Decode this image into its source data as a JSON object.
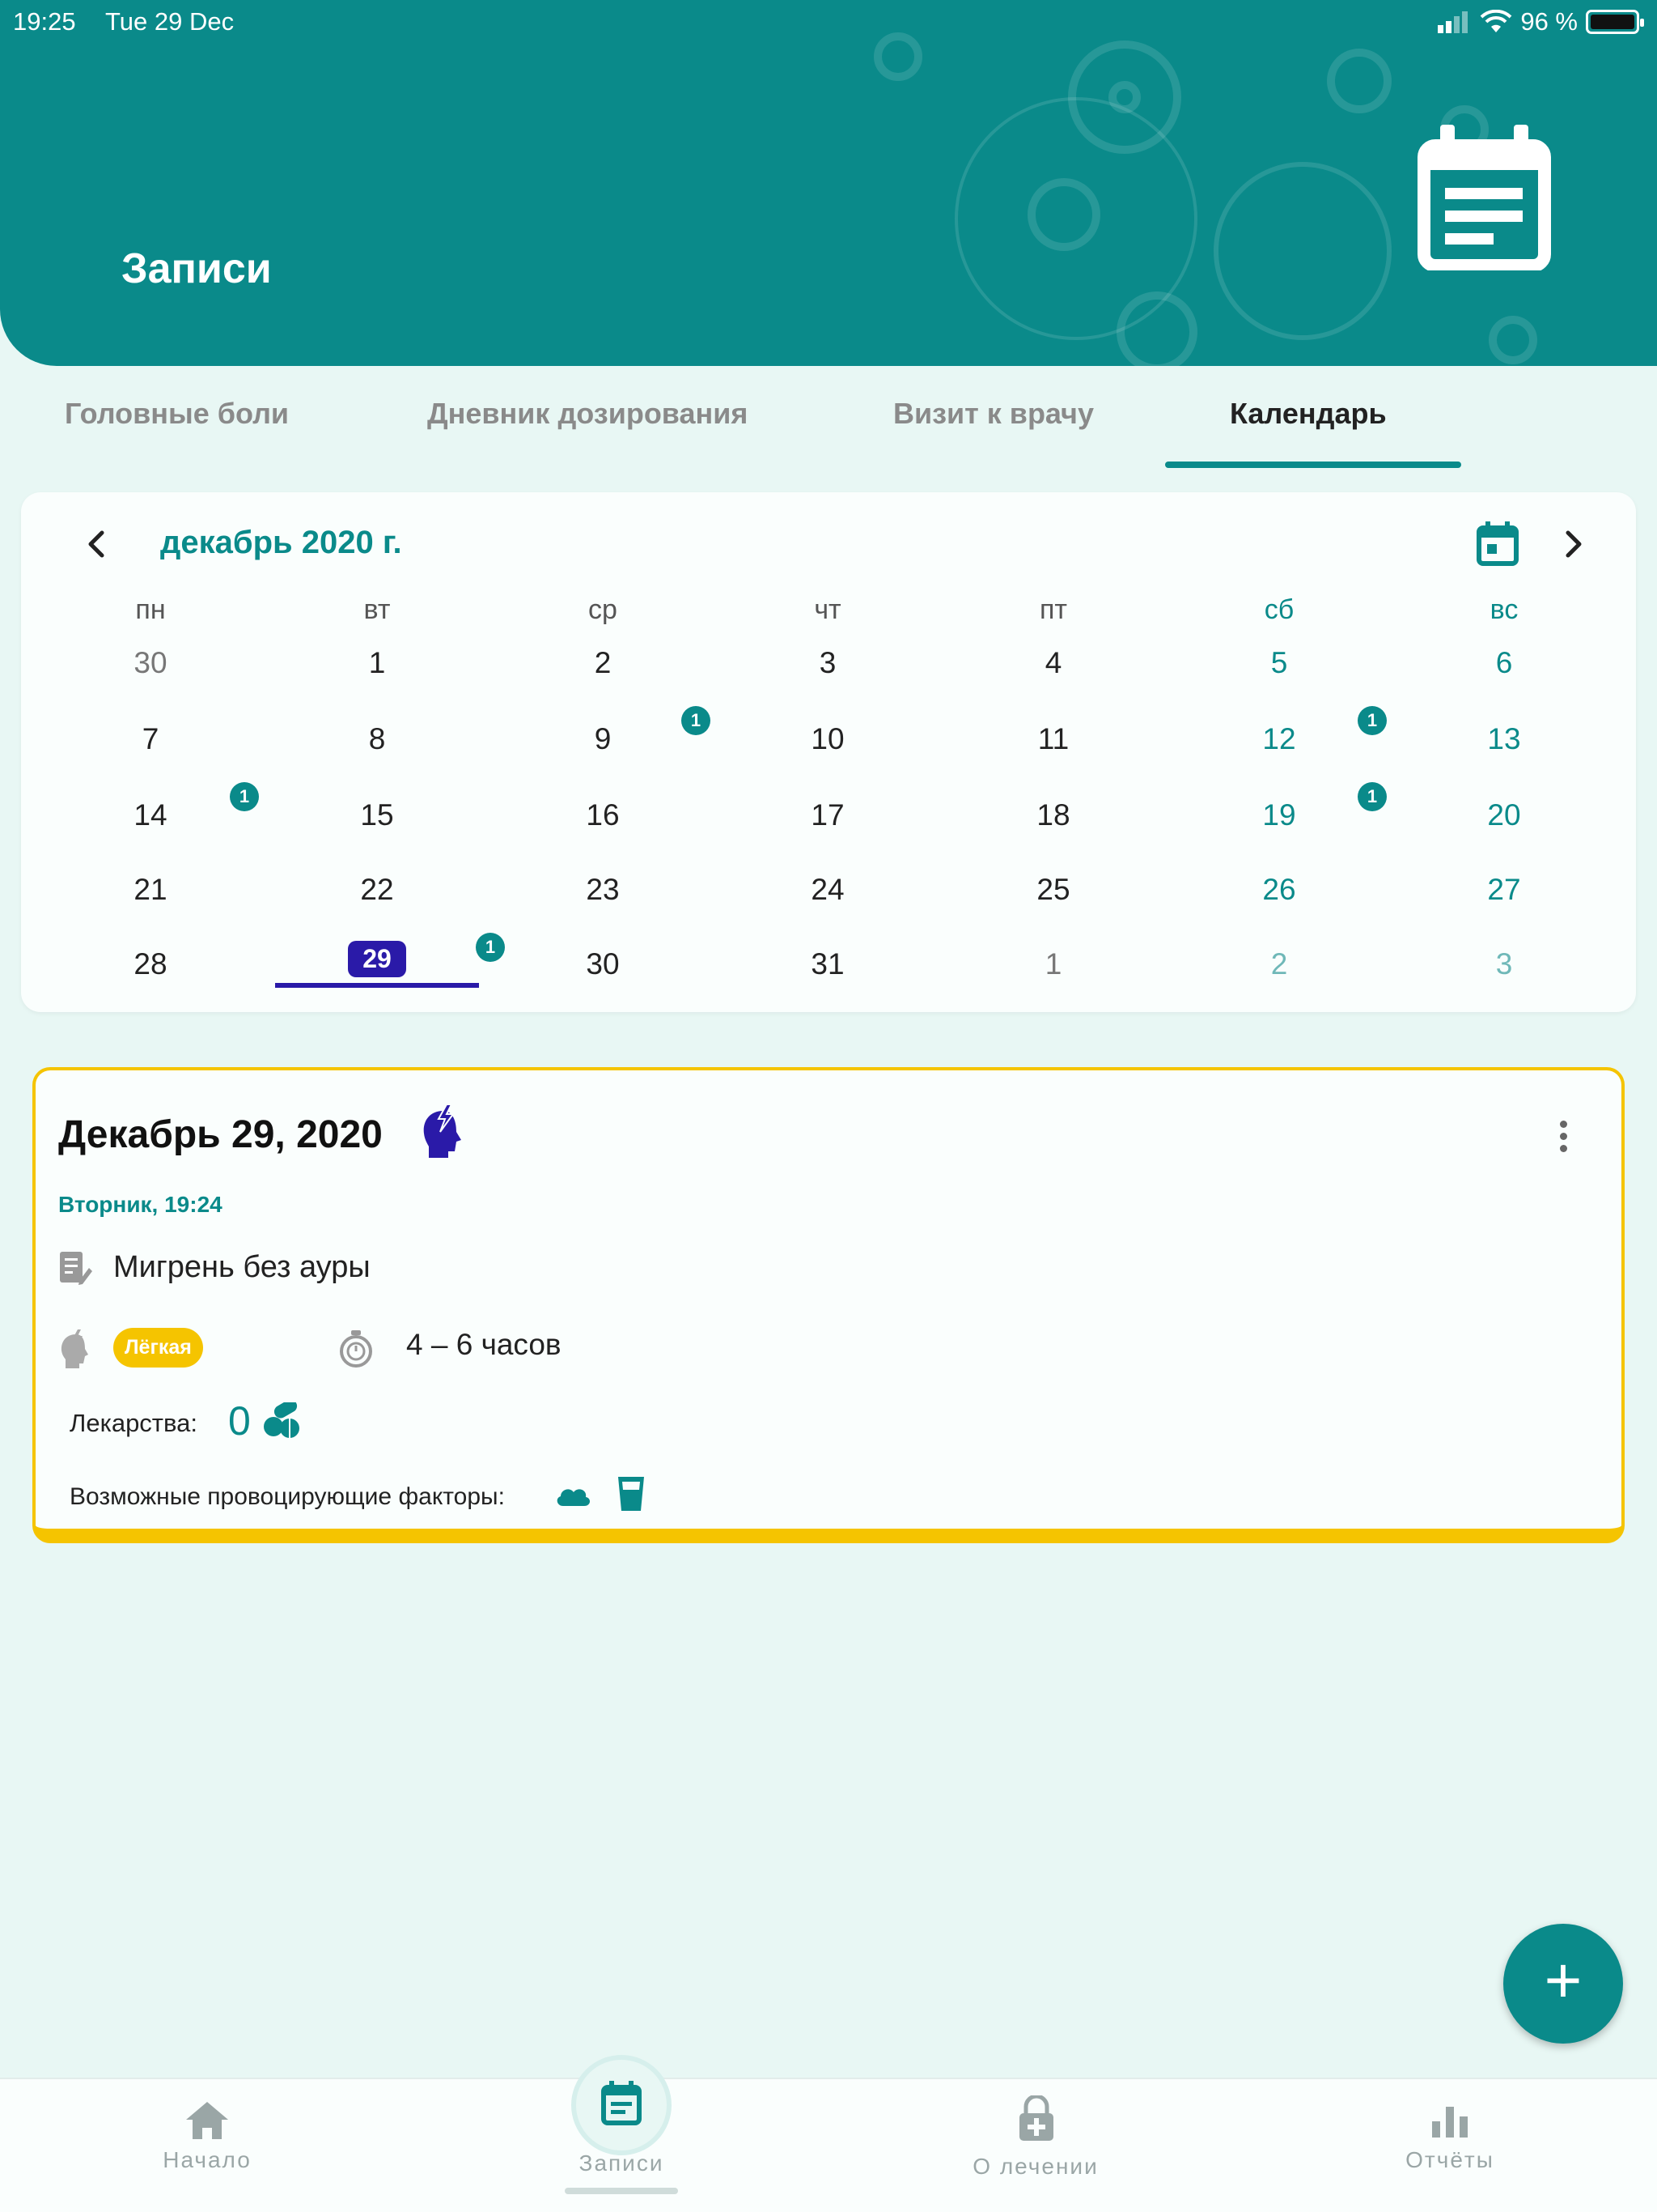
{
  "status": {
    "time": "19:25",
    "date": "Tue 29 Dec",
    "battery": "96 %"
  },
  "header": {
    "title": "Записи"
  },
  "tabs": [
    {
      "label": "Головные боли"
    },
    {
      "label": "Дневник дозирования"
    },
    {
      "label": "Визит к врачу"
    },
    {
      "label": "Календарь"
    }
  ],
  "calendar": {
    "month": "декабрь 2020 г.",
    "weekdays": [
      "пн",
      "вт",
      "ср",
      "чт",
      "пт",
      "сб",
      "вс"
    ],
    "weeks": [
      [
        "30",
        "1",
        "2",
        "3",
        "4",
        "5",
        "6"
      ],
      [
        "7",
        "8",
        "9",
        "10",
        "11",
        "12",
        "13"
      ],
      [
        "14",
        "15",
        "16",
        "17",
        "18",
        "19",
        "20"
      ],
      [
        "21",
        "22",
        "23",
        "24",
        "25",
        "26",
        "27"
      ],
      [
        "28",
        "29",
        "30",
        "31",
        "1",
        "2",
        "3"
      ]
    ],
    "today": "29",
    "badge_count": "1"
  },
  "entry": {
    "title": "Декабрь 29, 2020",
    "subtitle": "Вторник, 19:24",
    "diagnosis": "Мигрень без ауры",
    "severity": "Лёгкая",
    "duration": "4 – 6 часов",
    "medications_label": "Лекарства:",
    "medications_count": "0",
    "triggers_label": "Возможные провоцирующие факторы:"
  },
  "fab": {
    "label": "+"
  },
  "bottom_nav": [
    {
      "label": "Начало"
    },
    {
      "label": "Записи"
    },
    {
      "label": "О лечении"
    },
    {
      "label": "Отчёты"
    }
  ],
  "colors": {
    "primary": "#0a8a8a",
    "today": "#2a1aa8",
    "severity": "#f5c400",
    "background": "#e8f7f4"
  }
}
